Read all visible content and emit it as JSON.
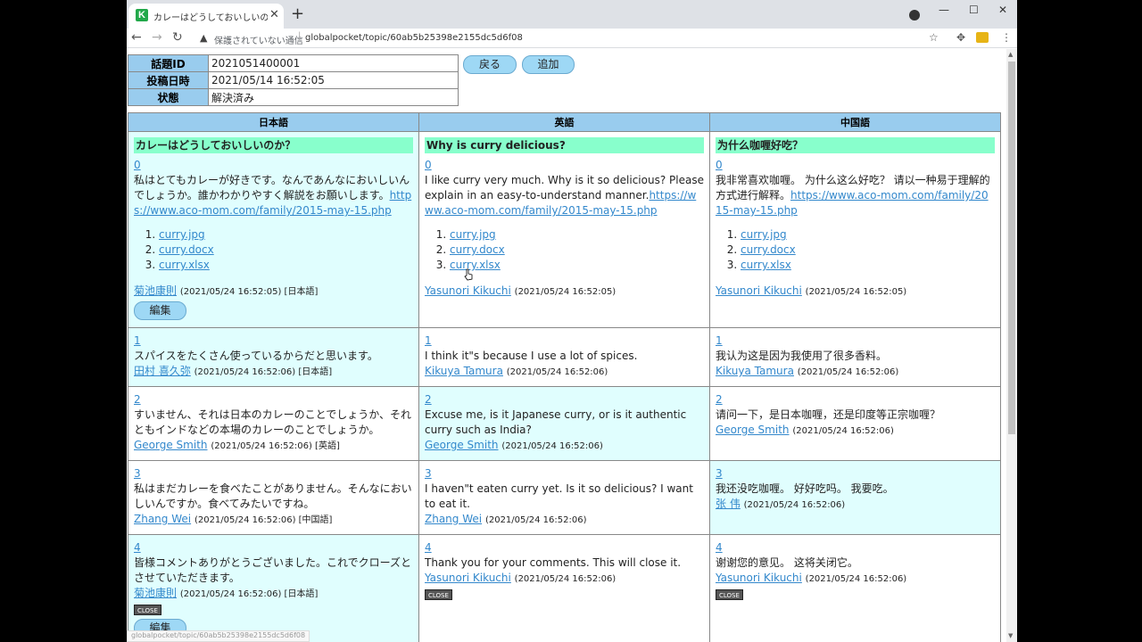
{
  "browser": {
    "tab_title": "カレーはどうしておいしいのか？ - 株式",
    "favicon_letter": "K",
    "security_text": "保護されていない通信",
    "url": "globalpocket/topic/60ab5b25398e2155dc5d6f08",
    "status_url": "globalpocket/topic/60ab5b25398e2155dc5d6f08"
  },
  "topic": {
    "labels": {
      "id": "話題ID",
      "posted": "投稿日時",
      "status": "状態"
    },
    "id": "2021051400001",
    "posted": "2021/05/14 16:52:05",
    "status": "解決済み"
  },
  "buttons": {
    "back": "戻る",
    "add": "追加",
    "edit": "編集",
    "close": "CLOSE"
  },
  "columns": [
    "日本語",
    "英語",
    "中国語"
  ],
  "question": {
    "num": "0",
    "cells": [
      {
        "title": "カレーはどうしておいしいのか？",
        "body": "私はとてもカレーが好きです。なんであんなにおいしいんでしょうか。誰かわかりやすく解説をお願いします。",
        "link": "https://www.aco-mom.com/family/2015-may-15.php",
        "files": [
          "curry.jpg",
          "curry.docx",
          "curry.xlsx"
        ],
        "author": "菊池康則",
        "meta": "(2021/05/24 16:52:05) [日本語]"
      },
      {
        "title": "Why is curry delicious?",
        "body": "I like curry very much. Why is it so delicious? Please explain in an easy-to-understand manner.",
        "link": "https://www.aco-mom.com/family/2015-may-15.php",
        "files": [
          "curry.jpg",
          "curry.docx",
          "curry.xlsx"
        ],
        "author": "Yasunori Kikuchi",
        "meta": "(2021/05/24 16:52:05)"
      },
      {
        "title": "为什么咖喱好吃？",
        "body": "我非常喜欢咖喱。 为什么这么好吃？ 请以一种易于理解的方式进行解释。",
        "link": "https://www.aco-mom.com/family/2015-may-15.php",
        "files": [
          "curry.jpg",
          "curry.docx",
          "curry.xlsx"
        ],
        "author": "Yasunori Kikuchi",
        "meta": "(2021/05/24 16:52:05)"
      }
    ]
  },
  "replies": [
    {
      "num": "1",
      "cells": [
        {
          "text": "スパイスをたくさん使っているからだと思います。",
          "author": "田村 喜久弥",
          "meta": "(2021/05/24 16:52:06) [日本語]"
        },
        {
          "text": "I think it\"s because I use a lot of spices.",
          "author": "Kikuya Tamura",
          "meta": "(2021/05/24 16:52:06)"
        },
        {
          "text": "我认为这是因为我使用了很多香料。",
          "author": "Kikuya Tamura",
          "meta": "(2021/05/24 16:52:06)"
        }
      ]
    },
    {
      "num": "2",
      "cells": [
        {
          "text": "すいません、それは日本のカレーのことでしょうか、それともインドなどの本場のカレーのことでしょうか。",
          "author": "George Smith",
          "meta": "(2021/05/24 16:52:06) [英語]"
        },
        {
          "text": "Excuse me, is it Japanese curry, or is it authentic curry such as India?",
          "author": "George Smith",
          "meta": "(2021/05/24 16:52:06)"
        },
        {
          "text": "请问一下，是日本咖喱，还是印度等正宗咖喱？",
          "author": "George Smith",
          "meta": "(2021/05/24 16:52:06)"
        }
      ]
    },
    {
      "num": "3",
      "cells": [
        {
          "text": "私はまだカレーを食べたことがありません。そんなにおいしいんですか。食べてみたいですね。",
          "author": "Zhang Wei",
          "meta": "(2021/05/24 16:52:06) [中国語]"
        },
        {
          "text": "I haven\"t eaten curry yet. Is it so delicious? I want to eat it.",
          "author": "Zhang Wei",
          "meta": "(2021/05/24 16:52:06)"
        },
        {
          "text": "我还没吃咖喱。 好好吃吗。 我要吃。",
          "author": "张 伟",
          "meta": "(2021/05/24 16:52:06)"
        }
      ]
    },
    {
      "num": "4",
      "cells": [
        {
          "text": "皆様コメントありがとうございました。これでクローズとさせていただきます。",
          "author": "菊池康則",
          "meta": "(2021/05/24 16:52:06) [日本語]"
        },
        {
          "text": "Thank you for your comments. This will close it.",
          "author": "Yasunori Kikuchi",
          "meta": "(2021/05/24 16:52:06)"
        },
        {
          "text": "谢谢您的意见。 这将关闭它。",
          "author": "Yasunori Kikuchi",
          "meta": "(2021/05/24 16:52:06)"
        }
      ]
    }
  ]
}
